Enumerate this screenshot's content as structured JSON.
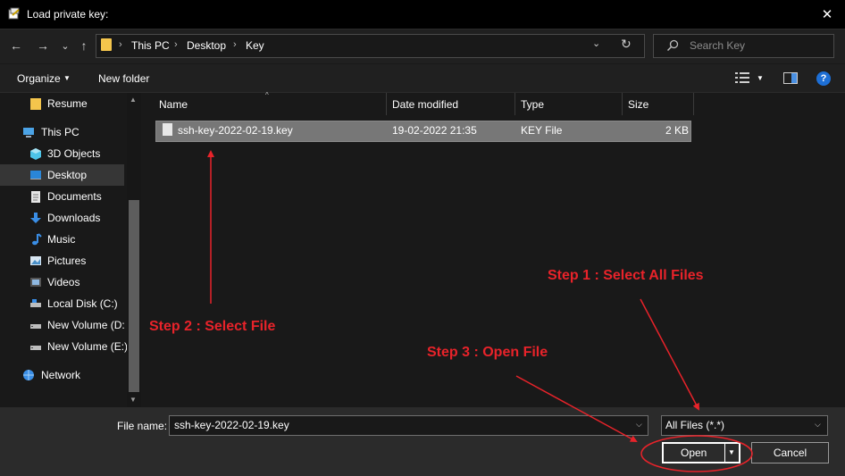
{
  "window": {
    "title": "Load private key:",
    "close": "✕"
  },
  "nav": {
    "back": "←",
    "forward": "→",
    "recent": "⌄",
    "up": "↑"
  },
  "address": {
    "crumbs": [
      "This PC",
      "Desktop",
      "Key"
    ],
    "sep": "›",
    "dropdown": "⌄",
    "refresh": "↻"
  },
  "search": {
    "placeholder": "Search Key"
  },
  "toolbar": {
    "organize": "Organize",
    "new_folder": "New folder",
    "help": "?",
    "caret": "▼"
  },
  "sidebar": {
    "items": [
      {
        "label": "Resume",
        "icon": "folder-icon"
      },
      {
        "label": "This PC",
        "icon": "computer-icon"
      },
      {
        "label": "3D Objects",
        "icon": "cube-icon"
      },
      {
        "label": "Desktop",
        "icon": "desktop-icon",
        "selected": true
      },
      {
        "label": "Documents",
        "icon": "document-icon"
      },
      {
        "label": "Downloads",
        "icon": "download-icon"
      },
      {
        "label": "Music",
        "icon": "music-icon"
      },
      {
        "label": "Pictures",
        "icon": "picture-icon"
      },
      {
        "label": "Videos",
        "icon": "video-icon"
      },
      {
        "label": "Local Disk (C:)",
        "icon": "drive-icon"
      },
      {
        "label": "New Volume (D:",
        "icon": "drive-icon"
      },
      {
        "label": "New Volume (E:)",
        "icon": "drive-icon"
      },
      {
        "label": "Network",
        "icon": "network-icon"
      }
    ],
    "scroll_up": "▲",
    "scroll_down": "▼"
  },
  "columns": {
    "name": "Name",
    "date": "Date modified",
    "type": "Type",
    "size": "Size",
    "sort_caret": "^"
  },
  "files": [
    {
      "name": "ssh-key-2022-02-19.key",
      "date": "19-02-2022 21:35",
      "type": "KEY File",
      "size": "2 KB"
    }
  ],
  "footer": {
    "file_name_label": "File name:",
    "file_name_value": "ssh-key-2022-02-19.key",
    "filter": "All Files (*.*)",
    "open": "Open",
    "cancel": "Cancel",
    "dropdown": "⌵",
    "split_caret": "▼"
  },
  "annotations": {
    "step1": "Step 1 : Select All Files",
    "step2": "Step 2 : Select File",
    "step3": "Step 3 : Open File",
    "color": "#e8232a"
  },
  "colors": {
    "background": "#191919",
    "selection": "#777777",
    "accent": "#1d6fd6",
    "folder": "#f4c54c"
  }
}
